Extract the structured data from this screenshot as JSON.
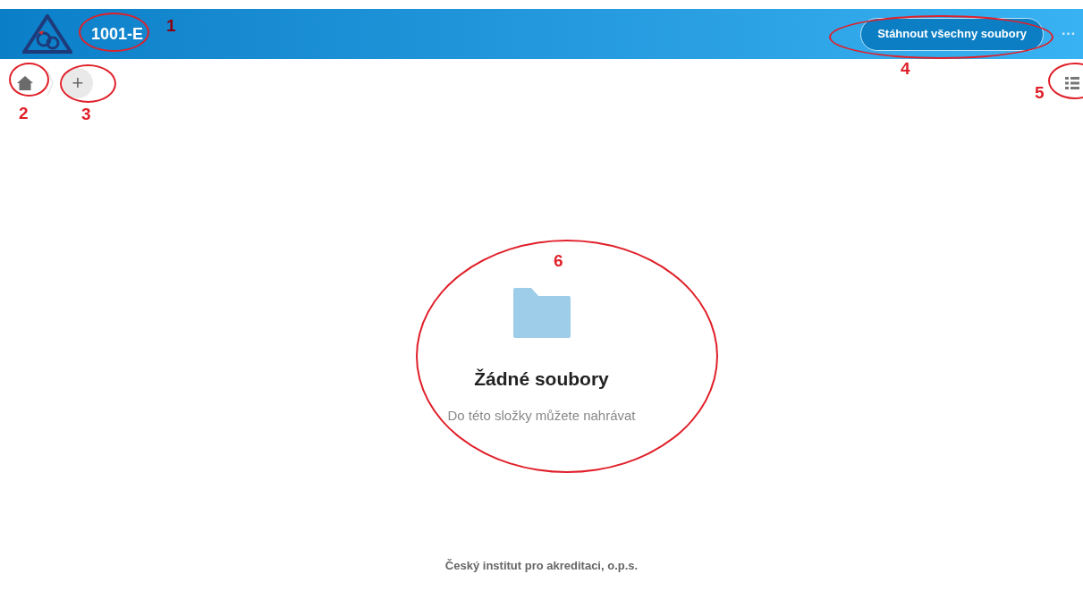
{
  "header": {
    "title": "1001-E",
    "download_button": "Stáhnout všechny soubory",
    "more": "···"
  },
  "toolbar": {
    "add_button": "+"
  },
  "empty_state": {
    "title": "Žádné soubory",
    "message": "Do této složky můžete nahrávat"
  },
  "footer": "Český institut pro akreditaci, o.p.s.",
  "annotations": [
    {
      "number": "1"
    },
    {
      "number": "2"
    },
    {
      "number": "3"
    },
    {
      "number": "4"
    },
    {
      "number": "5"
    },
    {
      "number": "6"
    }
  ]
}
